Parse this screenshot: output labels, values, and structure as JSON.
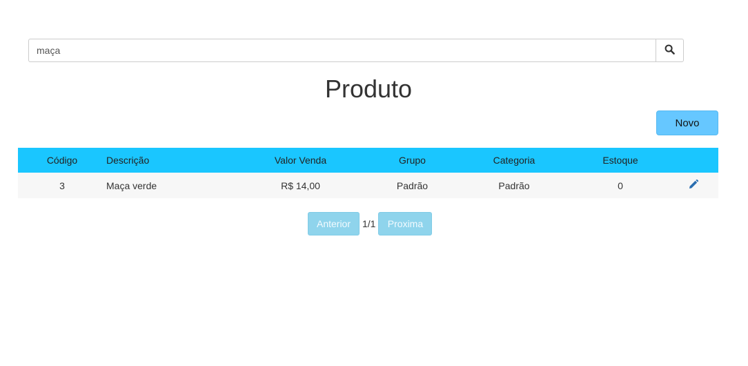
{
  "search": {
    "value": "maça",
    "icon": "search-icon"
  },
  "page": {
    "title": "Produto"
  },
  "toolbar": {
    "new_label": "Novo"
  },
  "table": {
    "headers": [
      "Código",
      "Descrição",
      "Valor Venda",
      "Grupo",
      "Categoria",
      "Estoque"
    ],
    "rows": [
      {
        "codigo": "3",
        "descricao": "Maça verde",
        "valor_venda": "R$ 14,00",
        "grupo": "Padrão",
        "categoria": "Padrão",
        "estoque": "0",
        "action_icon": "pencil-edit-icon"
      }
    ]
  },
  "pagination": {
    "prev_label": "Anterior",
    "info": "1/1",
    "next_label": "Proxima"
  },
  "colors": {
    "header_bg": "#1ac6ff",
    "new_button_bg": "#66c7ff",
    "pager_bg": "#8fd4ec",
    "edit_icon": "#2a6eb0"
  }
}
